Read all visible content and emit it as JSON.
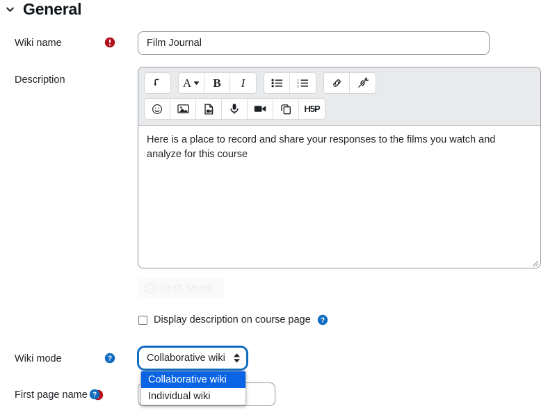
{
  "section": {
    "title": "General",
    "collapse_icon": "chevron-down-icon",
    "expanded": true
  },
  "fields": {
    "wiki_name": {
      "label": "Wiki name",
      "required": true,
      "required_icon": "required-exclamation-icon",
      "value": "Film Journal",
      "placeholder": ""
    },
    "description": {
      "label": "Description",
      "value": "Here is a place to record and share your responses to the films you watch and analyze for this course"
    },
    "display_description": {
      "label": "Display description on course page",
      "checked": false,
      "help_icon": "help-question-icon"
    },
    "wiki_mode": {
      "label": "Wiki mode",
      "help_icon": "help-question-icon",
      "value": "Collaborative wiki",
      "open": true,
      "options": [
        {
          "label": "Collaborative wiki",
          "selected": true
        },
        {
          "label": "Individual wiki",
          "selected": false
        }
      ]
    },
    "first_page_name": {
      "label": "First page name",
      "required": true,
      "required_icon": "required-exclamation-icon",
      "help_icon": "help-question-icon",
      "value": "",
      "placeholder": ""
    }
  },
  "editor": {
    "toolbar_rows": [
      {
        "groups": [
          {
            "buttons": [
              {
                "name": "expand-toolbar-icon",
                "title": "Show more buttons"
              }
            ]
          },
          {
            "buttons": [
              {
                "name": "text-style-icon",
                "title": "Styles"
              },
              {
                "name": "bold-icon",
                "title": "Bold"
              },
              {
                "name": "italic-icon",
                "title": "Italic"
              }
            ]
          },
          {
            "buttons": [
              {
                "name": "bulleted-list-icon",
                "title": "Bulleted list"
              },
              {
                "name": "numbered-list-icon",
                "title": "Numbered list"
              }
            ]
          },
          {
            "buttons": [
              {
                "name": "link-icon",
                "title": "Link"
              },
              {
                "name": "unlink-icon",
                "title": "Unlink"
              }
            ]
          }
        ]
      },
      {
        "groups": [
          {
            "buttons": [
              {
                "name": "emoji-icon",
                "title": "Emoji picker"
              },
              {
                "name": "image-icon",
                "title": "Image"
              },
              {
                "name": "media-file-icon",
                "title": "Multimedia"
              },
              {
                "name": "microphone-icon",
                "title": "Record audio"
              },
              {
                "name": "video-camera-icon",
                "title": "Record video"
              },
              {
                "name": "manage-files-icon",
                "title": "Manage files"
              },
              {
                "name": "h5p-icon",
                "title": "Insert H5P",
                "text": "H5P"
              }
            ]
          }
        ]
      }
    ]
  },
  "toast": {
    "icon": "info-circle-icon",
    "message": "Draft saved."
  },
  "colors": {
    "focus_ring": "#0f6cbf",
    "option_highlight": "#0a64e4",
    "required": "#b3121d",
    "help": "#0f6cbf",
    "toolbar_bg": "#e9eaeb",
    "border": "#8f959e"
  }
}
